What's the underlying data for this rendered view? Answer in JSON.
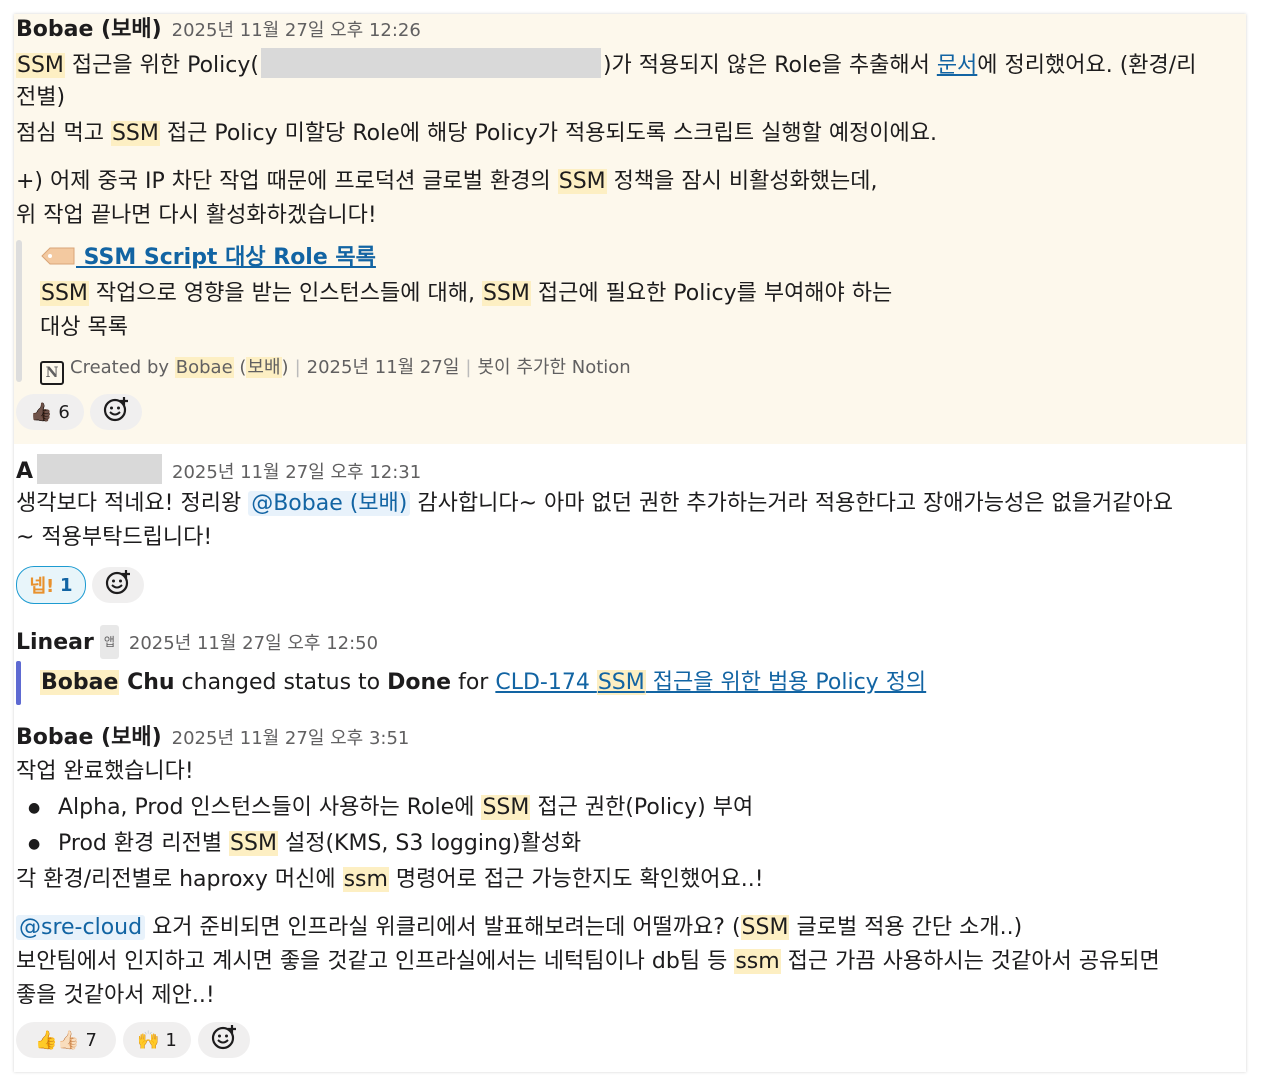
{
  "messages": [
    {
      "author": "Bobae (보배)",
      "timestamp": "2025년 11월 27일 오후 12:26",
      "line1_a": "SSM",
      "line1_b": " 접근을 위한 Policy(",
      "line1_c": ")가 적용되지 않은 Role을 추출해서 ",
      "line1_link": "문서",
      "line1_d": "에 정리했어요. (환경/리",
      "line2": "전별)",
      "line3_a": "점심 먹고 ",
      "line3_b": "SSM",
      "line3_c": " 접근 Policy 미할당 Role에 해당 Policy가 적용되도록 스크립트 실행할 예정이에요.",
      "line4_a": "+) 어제 중국 IP 차단 작업 때문에 프로덕션 글로벌 환경의 ",
      "line4_b": "SSM",
      "line4_c": " 정책을 잠시 비활성화했는데,",
      "line5": "위 작업 끝나면 다시 활성화하겠습니다!",
      "unfurl": {
        "title": " SSM Script 대상 Role 목록",
        "desc1_a": "SSM",
        "desc1_b": " 작업으로 영향을 받는 인스턴스들에 대해, ",
        "desc1_c": "SSM",
        "desc1_d": " 접근에 필요한 Policy를 부여해야 하는",
        "desc2": "대상 목록",
        "created_by": "Created by ",
        "creator": "Bobae",
        "creator_b": " (",
        "creator_c": "보배",
        "creator_d": ")",
        "date": "2025년 11월 27일",
        "added": "봇이 추가한 Notion"
      },
      "reactions": [
        {
          "emoji": "👍🏿",
          "count": "6"
        }
      ]
    },
    {
      "author": "A",
      "timestamp": "2025년 11월 27일 오후 12:31",
      "line1_a": "생각보다 적네요! 정리왕 ",
      "mention": "@Bobae (보배)",
      "line1_b": " 감사합니다~ 아마 없던 권한 추가하는거라 적용한다고 장애가능성은 없을거같아요",
      "line2": "~ 적용부탁드립니다!",
      "reactions": [
        {
          "emoji": "넵!",
          "count": "1"
        }
      ]
    },
    {
      "author": "Linear",
      "badge": "앱",
      "timestamp": "2025년 11월 27일 오후 12:50",
      "person_a": "Bobae",
      "person_b": " Chu",
      "text_a": " changed status to ",
      "status": "Done",
      "text_b": " for ",
      "issue_a": "CLD-174 ",
      "issue_b": "SSM",
      "issue_c": " 접근을 위한 범용 Policy 정의"
    },
    {
      "author": "Bobae (보배)",
      "timestamp": "2025년 11월 27일 오후 3:51",
      "line1": "작업 완료했습니다!",
      "bullet1_a": "Alpha, Prod 인스턴스들이 사용하는 Role에 ",
      "bullet1_b": "SSM",
      "bullet1_c": " 접근 권한(Policy) 부여",
      "bullet2_a": "Prod 환경 리전별 ",
      "bullet2_b": "SSM",
      "bullet2_c": " 설정(KMS, S3 logging)활성화",
      "line2_a": "각 환경/리전별로 haproxy 머신에 ",
      "line2_b": "ssm",
      "line2_c": " 명령어로 접근 가능한지도 확인했어요..!",
      "mention": "@sre-cloud",
      "line3_a": " 요거 준비되면 인프라실 위클리에서 발표해보려는데 어떨까요? (",
      "line3_b": "SSM",
      "line3_c": " 글로벌 적용 간단 소개..)",
      "line4_a": "보안팀에서 인지하고 계시면 좋을 것같고 인프라실에서는 네턱팀이나 db팀 등 ",
      "line4_b": "ssm",
      "line4_c": " 접근 가끔 사용하시는 것같아서 공유되면",
      "line5": "좋을 것같아서 제안..!",
      "reactions": [
        {
          "emoji": "👍👍🏻",
          "count": "7"
        },
        {
          "emoji": "🙌",
          "count": "1"
        }
      ]
    }
  ],
  "bullet_char": "●",
  "icons": {
    "add_reaction": "add-reaction-icon",
    "notion": "notion-icon",
    "tag": "tag-icon"
  },
  "colors": {
    "highlight": "#fdefc3",
    "link": "#1264a3",
    "linear_bar": "#5e6ad2",
    "msg_highlight_bg": "#fdf8ec"
  }
}
